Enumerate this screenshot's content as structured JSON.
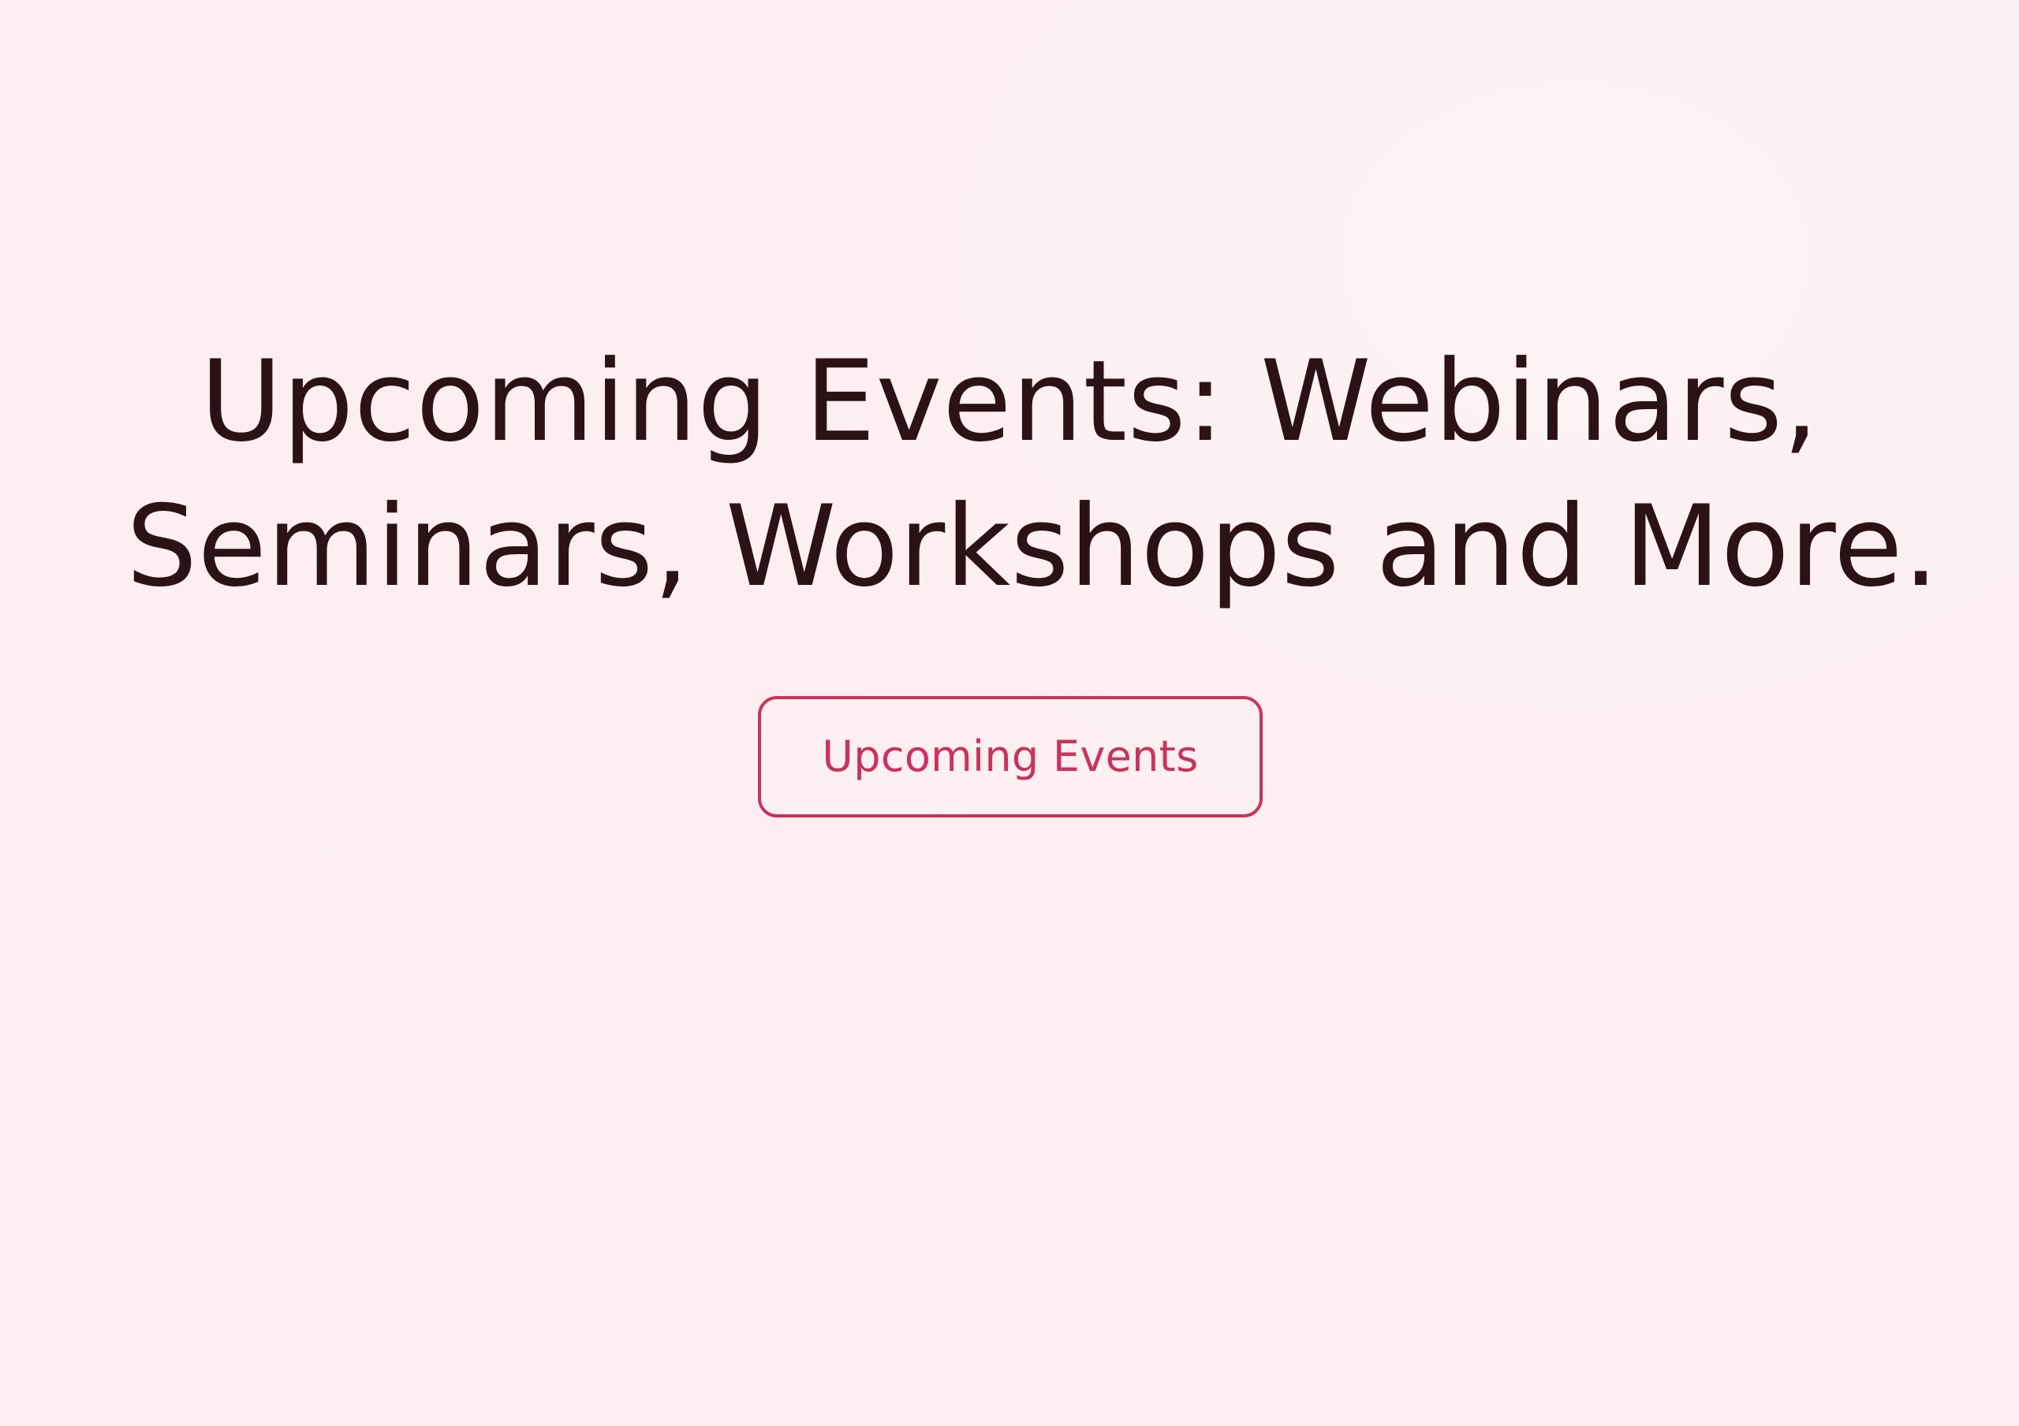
{
  "hero": {
    "headline_line_1": "Upcoming Events: Webinars,",
    "headline_line_2": "Seminars, Workshops and More.",
    "cta_label": "Upcoming Events"
  },
  "colors": {
    "background": "#fdeef1",
    "headline_text": "#2b1217",
    "accent": "#c9335d"
  }
}
